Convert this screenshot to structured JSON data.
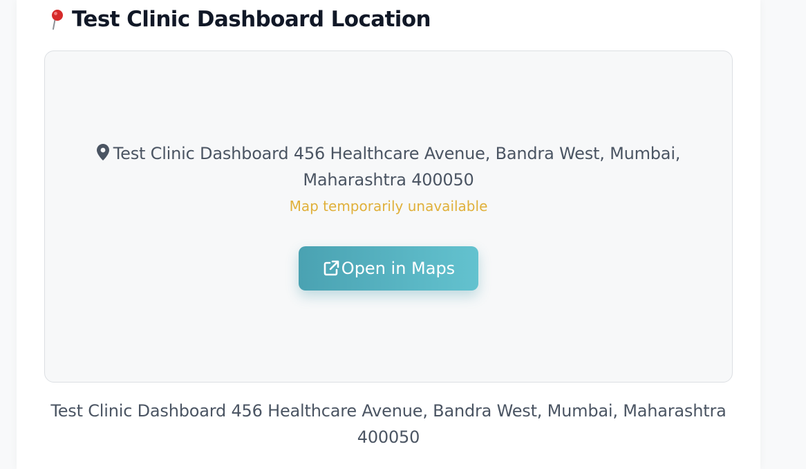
{
  "section": {
    "title": "Test Clinic Dashboard Location",
    "title_icon": "round-pushpin-icon"
  },
  "map_placeholder": {
    "marker_icon": "map-marker-icon",
    "address_line1": "Test Clinic Dashboard 456 Healthcare Avenue, Bandra West, Mumbai,",
    "address_line2": "Maharashtra 400050",
    "status_text": "Map temporarily unavailable",
    "status_color": "#e0b03a",
    "open_button": {
      "label": "Open in Maps",
      "icon": "external-link-icon",
      "gradient_start": "#4aa2b2",
      "gradient_end": "#63c2cf"
    }
  },
  "footer": {
    "address_line1": "Test Clinic Dashboard 456 Healthcare Avenue, Bandra West, Mumbai, Maharashtra",
    "address_line2": "400050"
  }
}
